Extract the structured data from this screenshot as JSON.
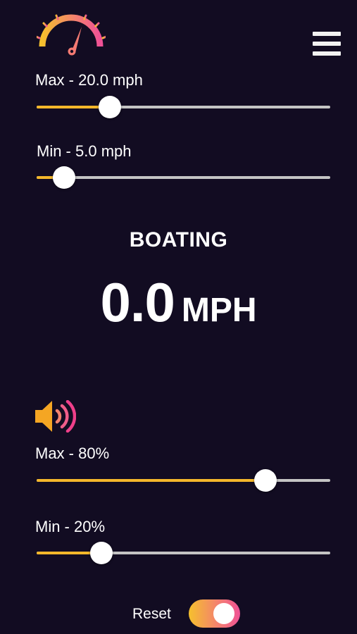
{
  "header": {
    "logo_icon": "speedometer-icon",
    "menu_icon": "hamburger-menu-icon"
  },
  "speed": {
    "max": {
      "label": "Max - 20.0 mph",
      "value": 20.0,
      "fraction": 0.25
    },
    "min": {
      "label": "Min - 5.0 mph",
      "value": 5.0,
      "fraction": 0.094
    }
  },
  "readout": {
    "mode": "BOATING",
    "value": "0.0",
    "unit": "MPH"
  },
  "volume": {
    "icon": "speaker-volume-icon",
    "max": {
      "label": "Max - 80%",
      "value": 80,
      "fraction": 0.78
    },
    "min": {
      "label": "Min - 20%",
      "value": 20,
      "fraction": 0.22
    }
  },
  "reset": {
    "label": "Reset",
    "on": true
  },
  "colors": {
    "background": "#120c22",
    "accent_yellow": "#f4b72b",
    "accent_pink": "#ef5196",
    "track": "#c4c4c4"
  }
}
